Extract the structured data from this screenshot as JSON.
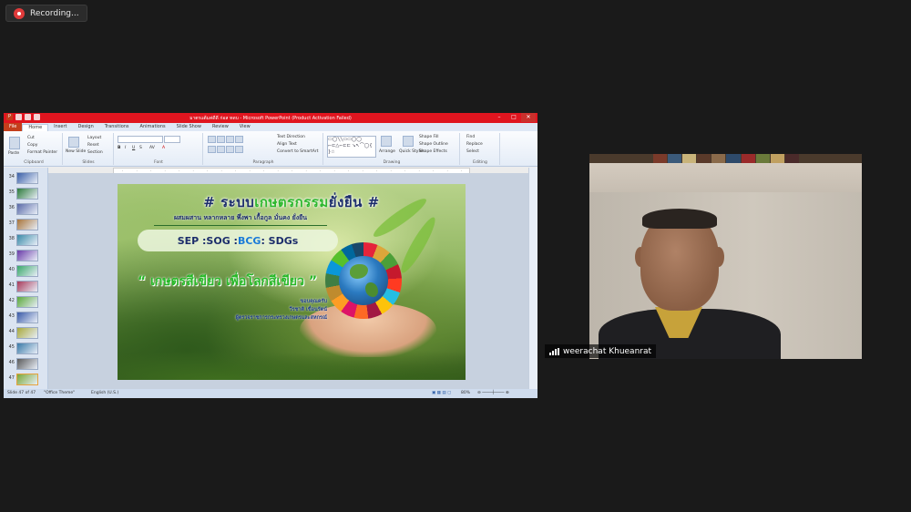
{
  "recording": {
    "label": "Recording..."
  },
  "window": {
    "title": "มาตรแต้มค่ดีดี ก่อส ทดบ - Microsoft PowerPoint (Product Activation Failed)"
  },
  "ribbon": {
    "tabs": [
      "File",
      "Home",
      "Insert",
      "Design",
      "Transitions",
      "Animations",
      "Slide Show",
      "Review",
      "View"
    ],
    "active_tab": "Home",
    "clipboard": {
      "cut": "Cut",
      "copy": "Copy",
      "format_painter": "Format Painter",
      "paste": "Paste",
      "label": "Clipboard"
    },
    "slides": {
      "new_slide": "New Slide",
      "layout": "Layout",
      "reset": "Reset",
      "section": "Section",
      "label": "Slides"
    },
    "font": {
      "label": "Font"
    },
    "paragraph": {
      "text_direction": "Text Direction",
      "align_text": "Align Text",
      "smartart": "Convert to SmartArt",
      "label": "Paragraph"
    },
    "drawing": {
      "arrange": "Arrange",
      "quick_styles": "Quick Styles",
      "shape_fill": "Shape Fill",
      "shape_outline": "Shape Outline",
      "shape_effects": "Shape Effects",
      "label": "Drawing"
    },
    "editing": {
      "find": "Find",
      "replace": "Replace",
      "select": "Select",
      "label": "Editing"
    }
  },
  "thumbnails": {
    "numbers": [
      "34",
      "35",
      "36",
      "37",
      "38",
      "39",
      "40",
      "41",
      "42",
      "43",
      "44",
      "45",
      "46",
      "47"
    ],
    "selected": "47"
  },
  "slide": {
    "title_pre": "# ระบบ",
    "title_hl": "เกษตรกรรม",
    "title_post": "ยั่งยืน #",
    "subtitle": "ผสมผสาน  หลากหลาย  พึ่งพา  เกื้อกูล  มั่นคง  ยั่งยืน",
    "box_sep": "SEP : ",
    "box_sog": "SOG : ",
    "box_bcg": "BCG",
    "box_sdgs": " : SDGs",
    "slogan": "“ เกษตรสีเขียว เพื่อโลกสีเขียว ”",
    "credit_1": "ขอบคุณครับ",
    "credit_2": "วีรชาติ  เขื่อนรัตน์",
    "credit_3": "ผู้ตรวจราชการกระทรวงเกษตรและสหกรณ์"
  },
  "statusbar": {
    "slide_info": "Slide 47 of 47",
    "theme": "\"Office Theme\"",
    "language": "English (U.S.)",
    "zoom": "80%"
  },
  "participant": {
    "name": "weerachat Khueanrat"
  }
}
